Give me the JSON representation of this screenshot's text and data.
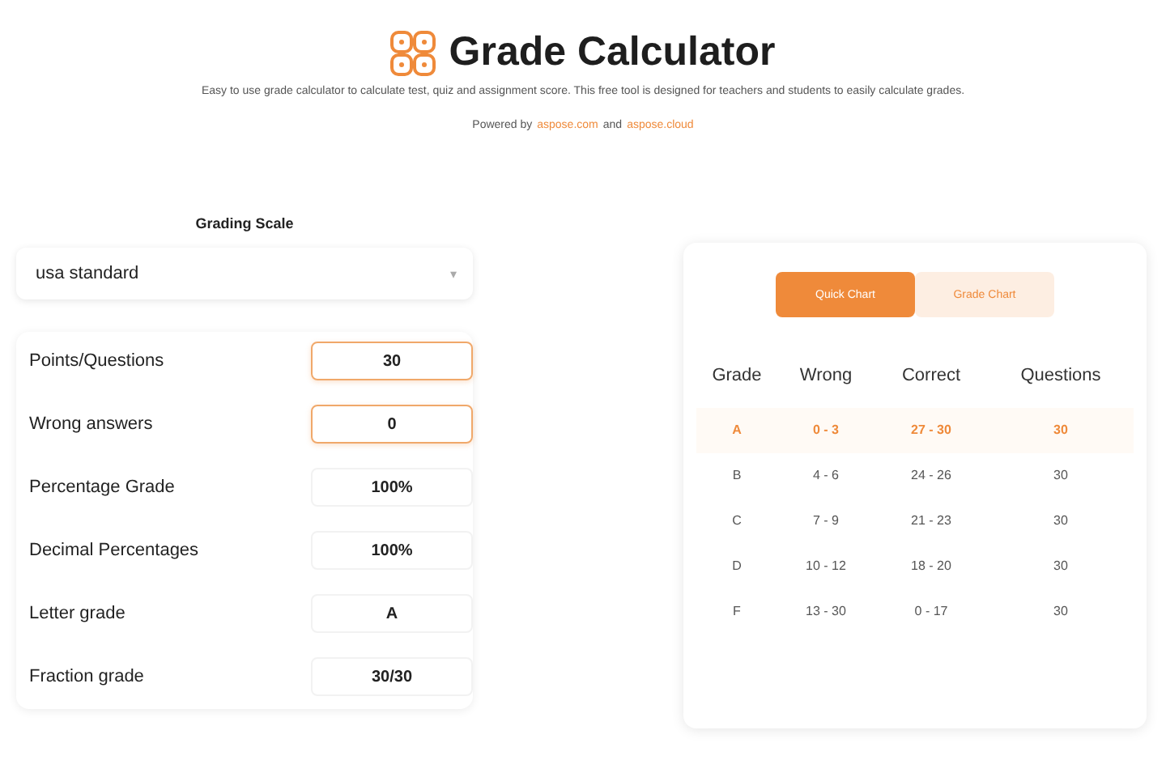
{
  "header": {
    "title": "Grade Calculator",
    "description": "Easy to use grade calculator to calculate test, quiz and assignment score. This free tool is designed for teachers and students to easily calculate grades.",
    "powered_by": "Powered by",
    "links": [
      "aspose.com",
      "aspose.cloud"
    ],
    "conjunction": "and"
  },
  "scale": {
    "label": "Grading Scale",
    "value": "usa standard",
    "caret": "▾"
  },
  "fields": [
    {
      "label": "Points/Questions",
      "value": "30",
      "kind": "input"
    },
    {
      "label": "Wrong answers",
      "value": "0",
      "kind": "input"
    },
    {
      "label": "Percentage Grade",
      "value": "100%",
      "kind": "output"
    },
    {
      "label": "Decimal Percentages",
      "value": "100%",
      "kind": "output"
    },
    {
      "label": "Letter grade",
      "value": "A",
      "kind": "output"
    },
    {
      "label": "Fraction grade",
      "value": "30/30",
      "kind": "output"
    }
  ],
  "tabs": [
    {
      "label": "Quick Chart",
      "selected": true
    },
    {
      "label": "Grade Chart",
      "selected": false
    }
  ],
  "table": {
    "columns": [
      "Grade",
      "Wrong",
      "Correct",
      "Questions"
    ],
    "rows": [
      {
        "cells": [
          "A",
          "0 - 3",
          "27 - 30",
          "30"
        ],
        "selected": true
      },
      {
        "cells": [
          "B",
          "4 - 6",
          "24 - 26",
          "30"
        ],
        "selected": false
      },
      {
        "cells": [
          "C",
          "7 - 9",
          "21 - 23",
          "30"
        ],
        "selected": false
      },
      {
        "cells": [
          "D",
          "10 - 12",
          "18 - 20",
          "30"
        ],
        "selected": false
      },
      {
        "cells": [
          "F",
          "13 - 30",
          "0 - 17",
          "30"
        ],
        "selected": false
      }
    ]
  }
}
